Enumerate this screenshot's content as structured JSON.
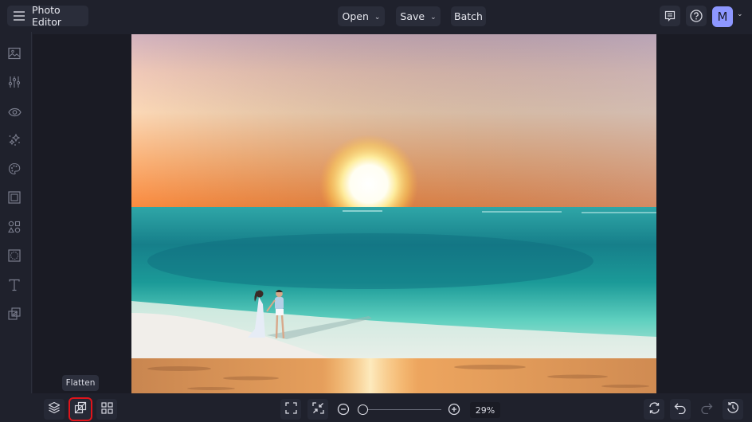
{
  "app": {
    "title": "Photo Editor"
  },
  "topbar": {
    "menu_icon": "hamburger-icon",
    "open_label": "Open",
    "save_label": "Save",
    "batch_label": "Batch",
    "feedback_icon": "feedback-icon",
    "help_icon": "help-icon",
    "avatar_initial": "M",
    "accent_color": "#8d97ff"
  },
  "sidebar": {
    "items": [
      {
        "name": "image",
        "icon": "image-icon"
      },
      {
        "name": "adjust",
        "icon": "sliders-icon"
      },
      {
        "name": "effects",
        "icon": "eye-icon"
      },
      {
        "name": "touch-up",
        "icon": "sparkle-icon"
      },
      {
        "name": "artsy",
        "icon": "palette-icon"
      },
      {
        "name": "frames",
        "icon": "frame-icon"
      },
      {
        "name": "graphics",
        "icon": "shapes-icon"
      },
      {
        "name": "overlays",
        "icon": "overlay-icon"
      },
      {
        "name": "text",
        "icon": "text-icon"
      },
      {
        "name": "textures",
        "icon": "texture-icon"
      }
    ]
  },
  "canvas": {
    "photo_description": "Sunset beach with couple walking on sand"
  },
  "bottombar": {
    "layers_icon": "layers-icon",
    "flatten_icon": "flatten-icon",
    "flatten_tooltip": "Flatten",
    "grid_icon": "grid-icon",
    "fit_icon": "fit-screen-icon",
    "actual_size_icon": "shrink-icon",
    "zoom_out_icon": "zoom-out-icon",
    "zoom_in_icon": "zoom-in-icon",
    "zoom_level": "29%",
    "zoom_fraction": 0.05,
    "replace_icon": "replace-icon",
    "undo_icon": "undo-icon",
    "redo_icon": "redo-icon",
    "history_icon": "history-icon",
    "highlight_color": "#e0141b"
  }
}
